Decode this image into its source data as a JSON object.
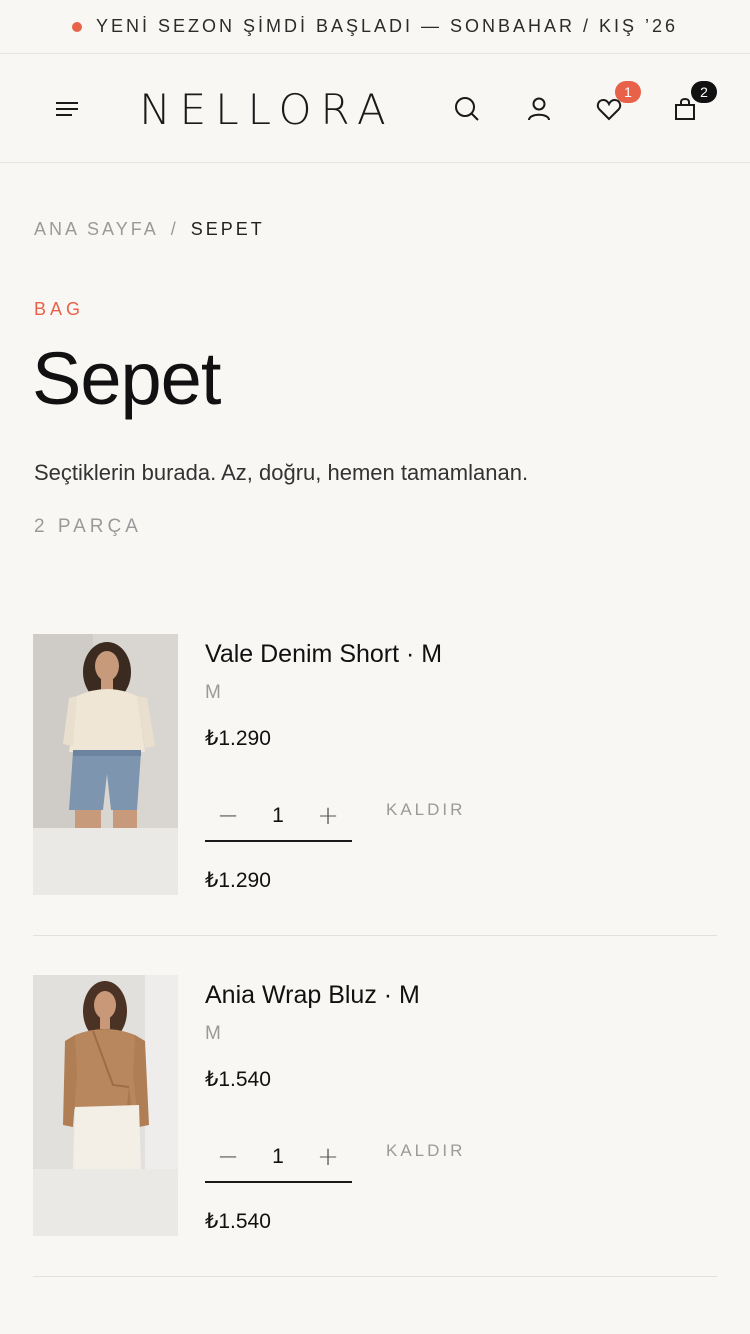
{
  "announcement": {
    "text": "YENİ SEZON ŞİMDİ BAŞLADI — SONBAHAR / KIŞ ’26",
    "dot_color": "#e8624a"
  },
  "header": {
    "logo": "NELLORA",
    "icons": [
      "menu-icon",
      "search-icon",
      "user-icon",
      "heart-icon",
      "bag-icon"
    ],
    "wishlist_count": "1",
    "bag_count": "2",
    "accent_color": "#e8624a"
  },
  "breadcrumb": {
    "home": "ANA SAYFA",
    "separator": "/",
    "current": "SEPET"
  },
  "page": {
    "eyebrow": "BAG",
    "title": "Sepet",
    "subtitle": "Seçtiklerin burada. Az, doğru, hemen tamamlanan.",
    "count": "2 PARÇA"
  },
  "items": [
    {
      "name": "Vale Denim Short · M",
      "size": "M",
      "price": "₺1.290",
      "quantity": "1",
      "minus": "−",
      "plus": "+",
      "remove": "KALDIR",
      "total": "₺1.290"
    },
    {
      "name": "Ania Wrap Bluz · M",
      "size": "M",
      "price": "₺1.540",
      "quantity": "1",
      "minus": "−",
      "plus": "+",
      "remove": "KALDIR",
      "total": "₺1.540"
    }
  ]
}
